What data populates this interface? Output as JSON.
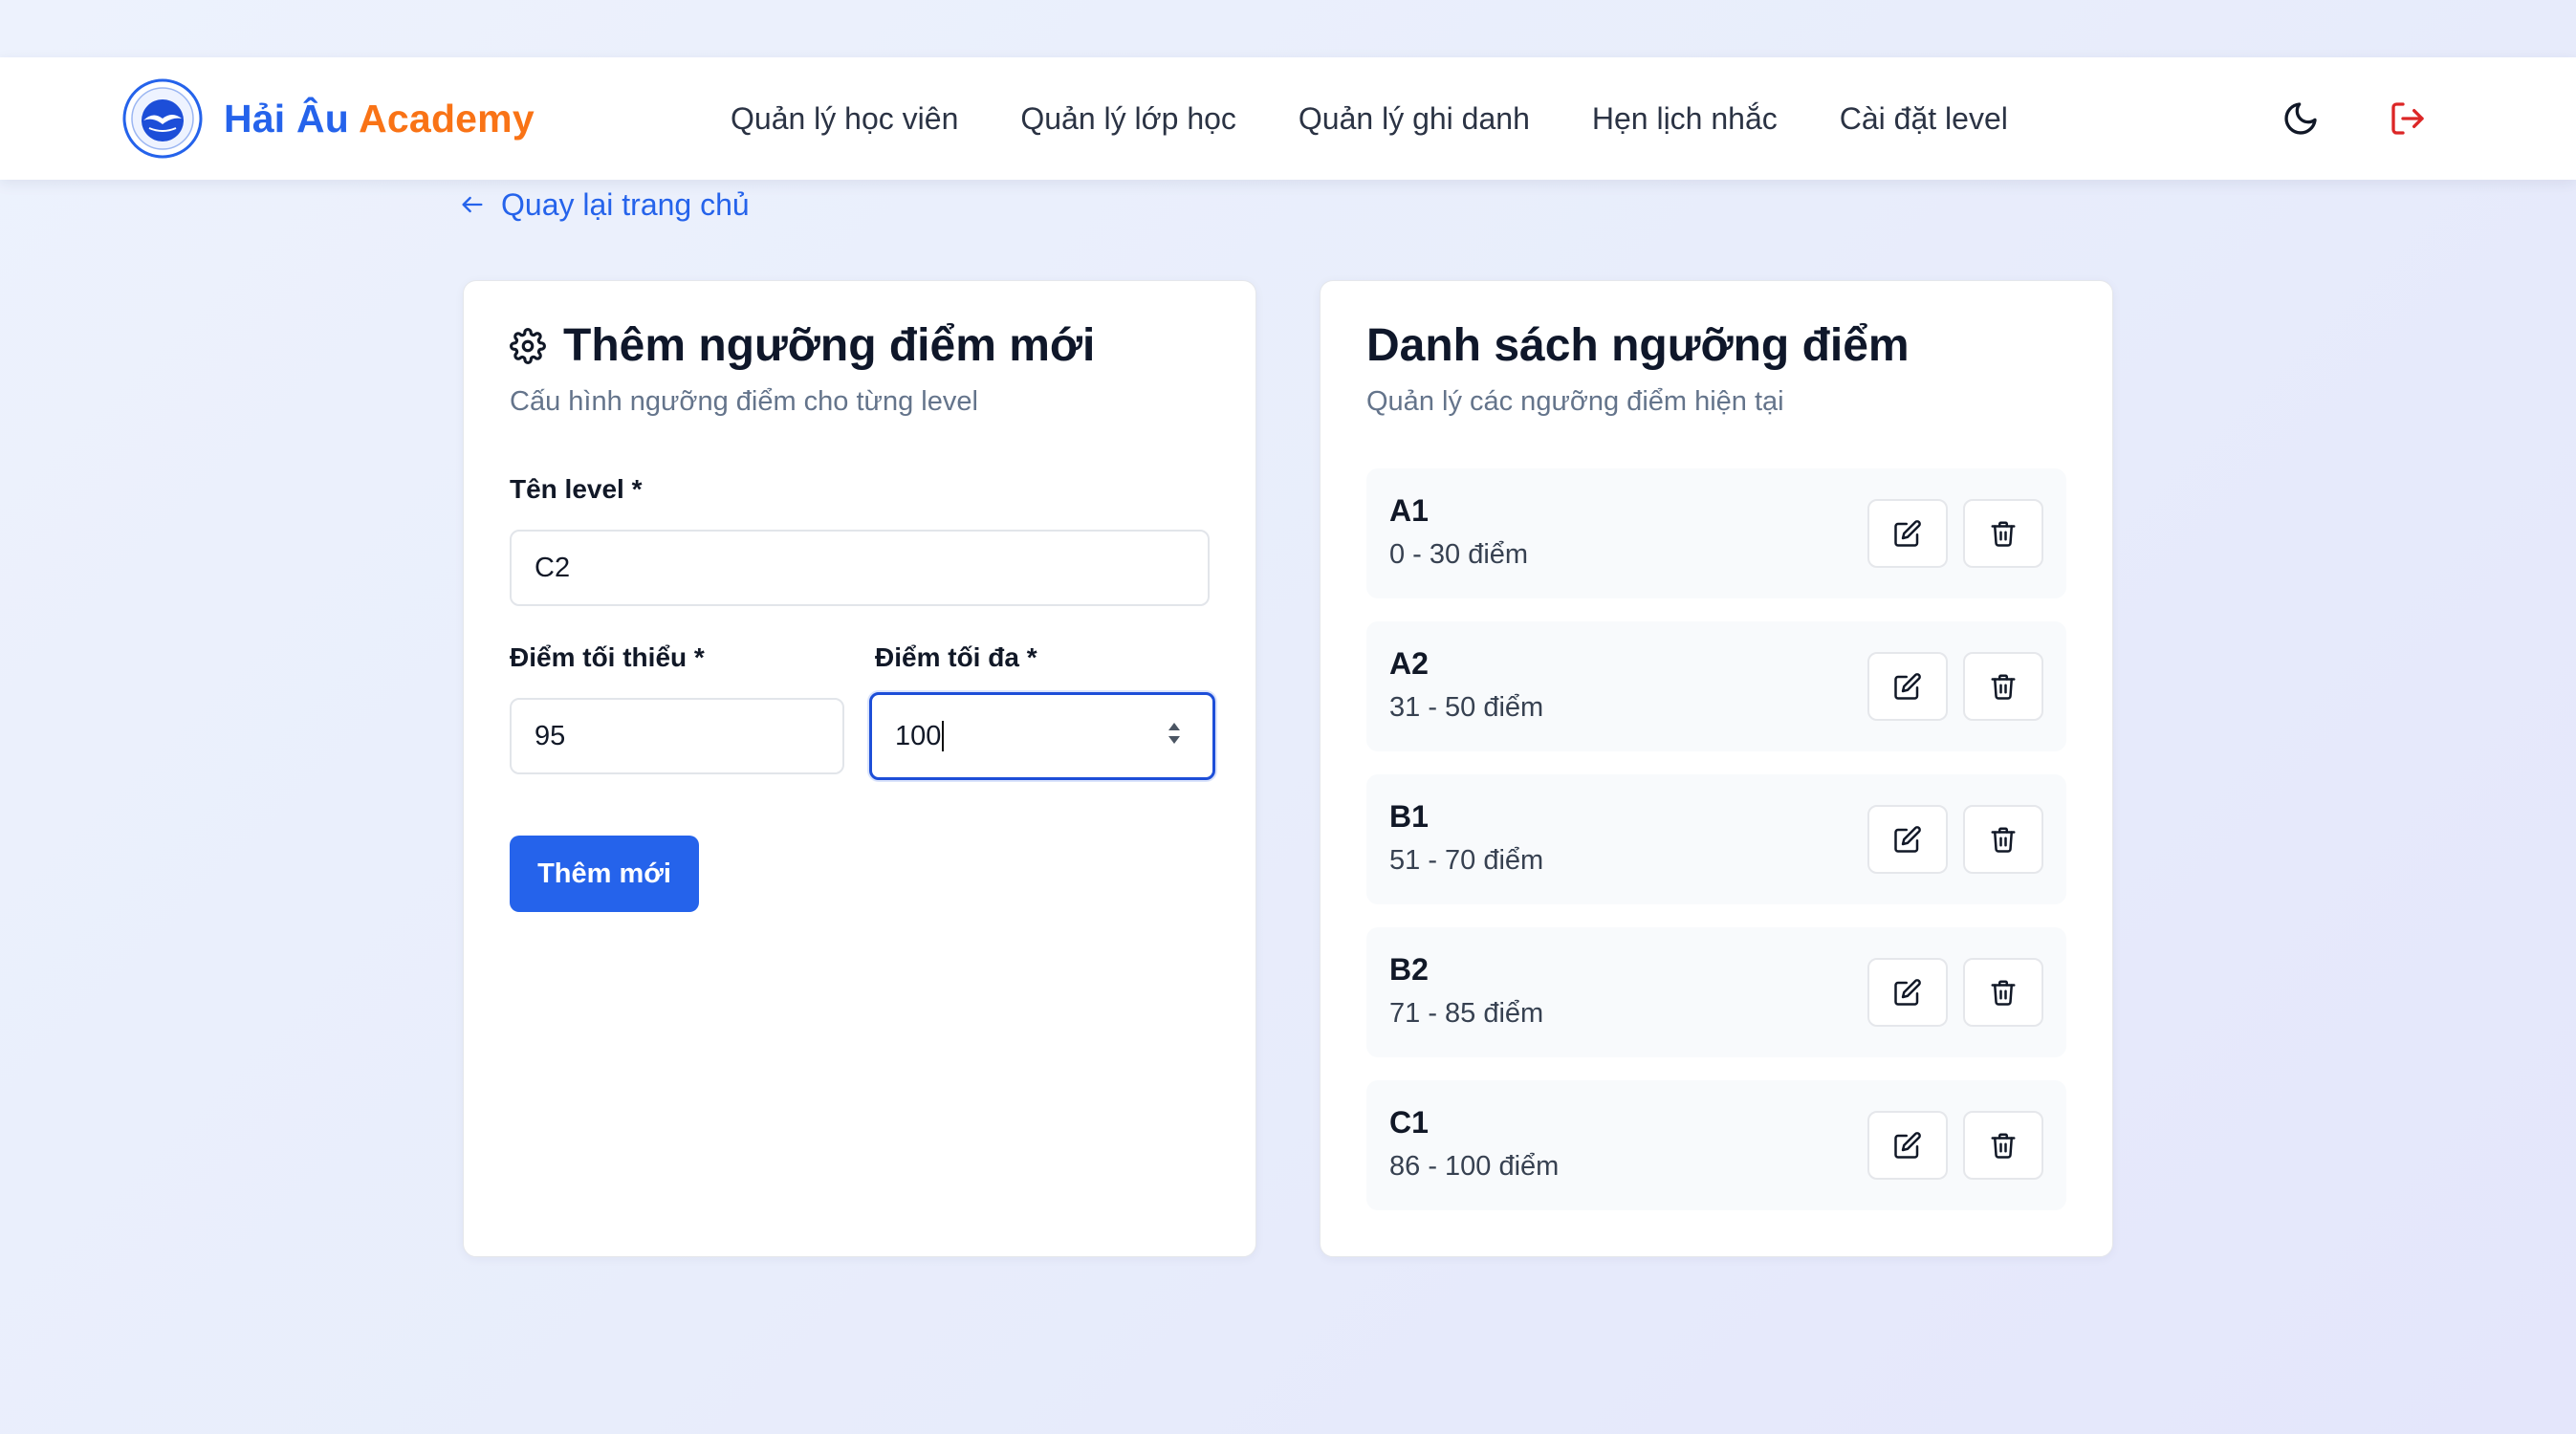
{
  "brand": {
    "name_part1": "Hải Âu",
    "name_part2": "Academy",
    "color_primary": "#2563eb",
    "color_accent": "#f97316"
  },
  "nav": {
    "items": [
      {
        "label": "Quản lý học viên"
      },
      {
        "label": "Quản lý lớp học"
      },
      {
        "label": "Quản lý ghi danh"
      },
      {
        "label": "Hẹn lịch nhắc"
      },
      {
        "label": "Cài đặt level"
      }
    ],
    "theme_icon": "moon-icon",
    "logout_icon": "logout-icon"
  },
  "back_link": {
    "label": "Quay lại trang chủ"
  },
  "add_form": {
    "title": "Thêm ngưỡng điểm mới",
    "subtitle": "Cấu hình ngưỡng điểm cho từng level",
    "level_label": "Tên level *",
    "level_value": "C2",
    "min_label": "Điểm tối thiểu *",
    "min_value": "95",
    "max_label": "Điểm tối đa *",
    "max_value": "100",
    "submit_label": "Thêm mới"
  },
  "thresholds": {
    "title": "Danh sách ngưỡng điểm",
    "subtitle": "Quản lý các ngưỡng điểm hiện tại",
    "items": [
      {
        "name": "A1",
        "range": "0 - 30 điểm"
      },
      {
        "name": "A2",
        "range": "31 - 50 điểm"
      },
      {
        "name": "B1",
        "range": "51 - 70 điểm"
      },
      {
        "name": "B2",
        "range": "71 - 85 điểm"
      },
      {
        "name": "C1",
        "range": "86 - 100 điểm"
      }
    ]
  }
}
